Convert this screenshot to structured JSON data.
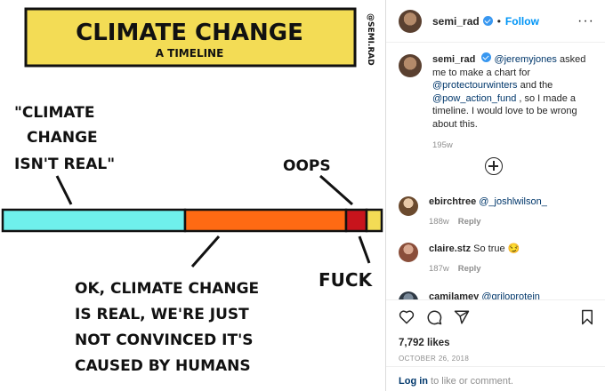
{
  "post": {
    "username": "semi_rad",
    "follow_label": "Follow",
    "more_label": "···",
    "image": {
      "title": "CLIMATE CHANGE",
      "subtitle": "A TIMELINE",
      "watermark": "@SEMI.RAD",
      "quote_line1": "\"CLIMATE",
      "quote_line2": "CHANGE",
      "quote_line3": "ISN'T REAL\"",
      "oops": "OOPS",
      "ok_line1": "OK, CLIMATE CHANGE",
      "ok_line2": "IS REAL, WE'RE JUST",
      "ok_line3": "NOT CONVINCED IT'S",
      "ok_line4": "CAUSED BY HUMANS",
      "fuck": "FUCK",
      "colors": {
        "banner": "#f3dc55",
        "segment1": "#6ff0ec",
        "segment2": "#ff6a13",
        "segment3": "#c8141c",
        "segment4": "#f3dc55"
      }
    }
  },
  "caption": {
    "username": "semi_rad",
    "mention1": "@jeremyjones",
    "text1": " asked me to make a chart for ",
    "mention2": "@protectourwinters",
    "text2": " and the ",
    "mention3": "@pow_action_fund",
    "text3": " , so I made a timeline. I would love to be wrong about this.",
    "time": "195w"
  },
  "comments": [
    {
      "username": "ebirchtree",
      "text": "@_joshlwilson_",
      "time": "188w",
      "reply": "Reply"
    },
    {
      "username": "claire.stz",
      "text": "So true 😏",
      "time": "187w",
      "reply": "Reply"
    },
    {
      "username": "camilamey",
      "text": "@griloprotein",
      "time": "",
      "reply": ""
    }
  ],
  "likes": "7,792 likes",
  "date": "OCTOBER 26, 2018",
  "login": {
    "link": "Log in",
    "text": " to like or comment."
  }
}
